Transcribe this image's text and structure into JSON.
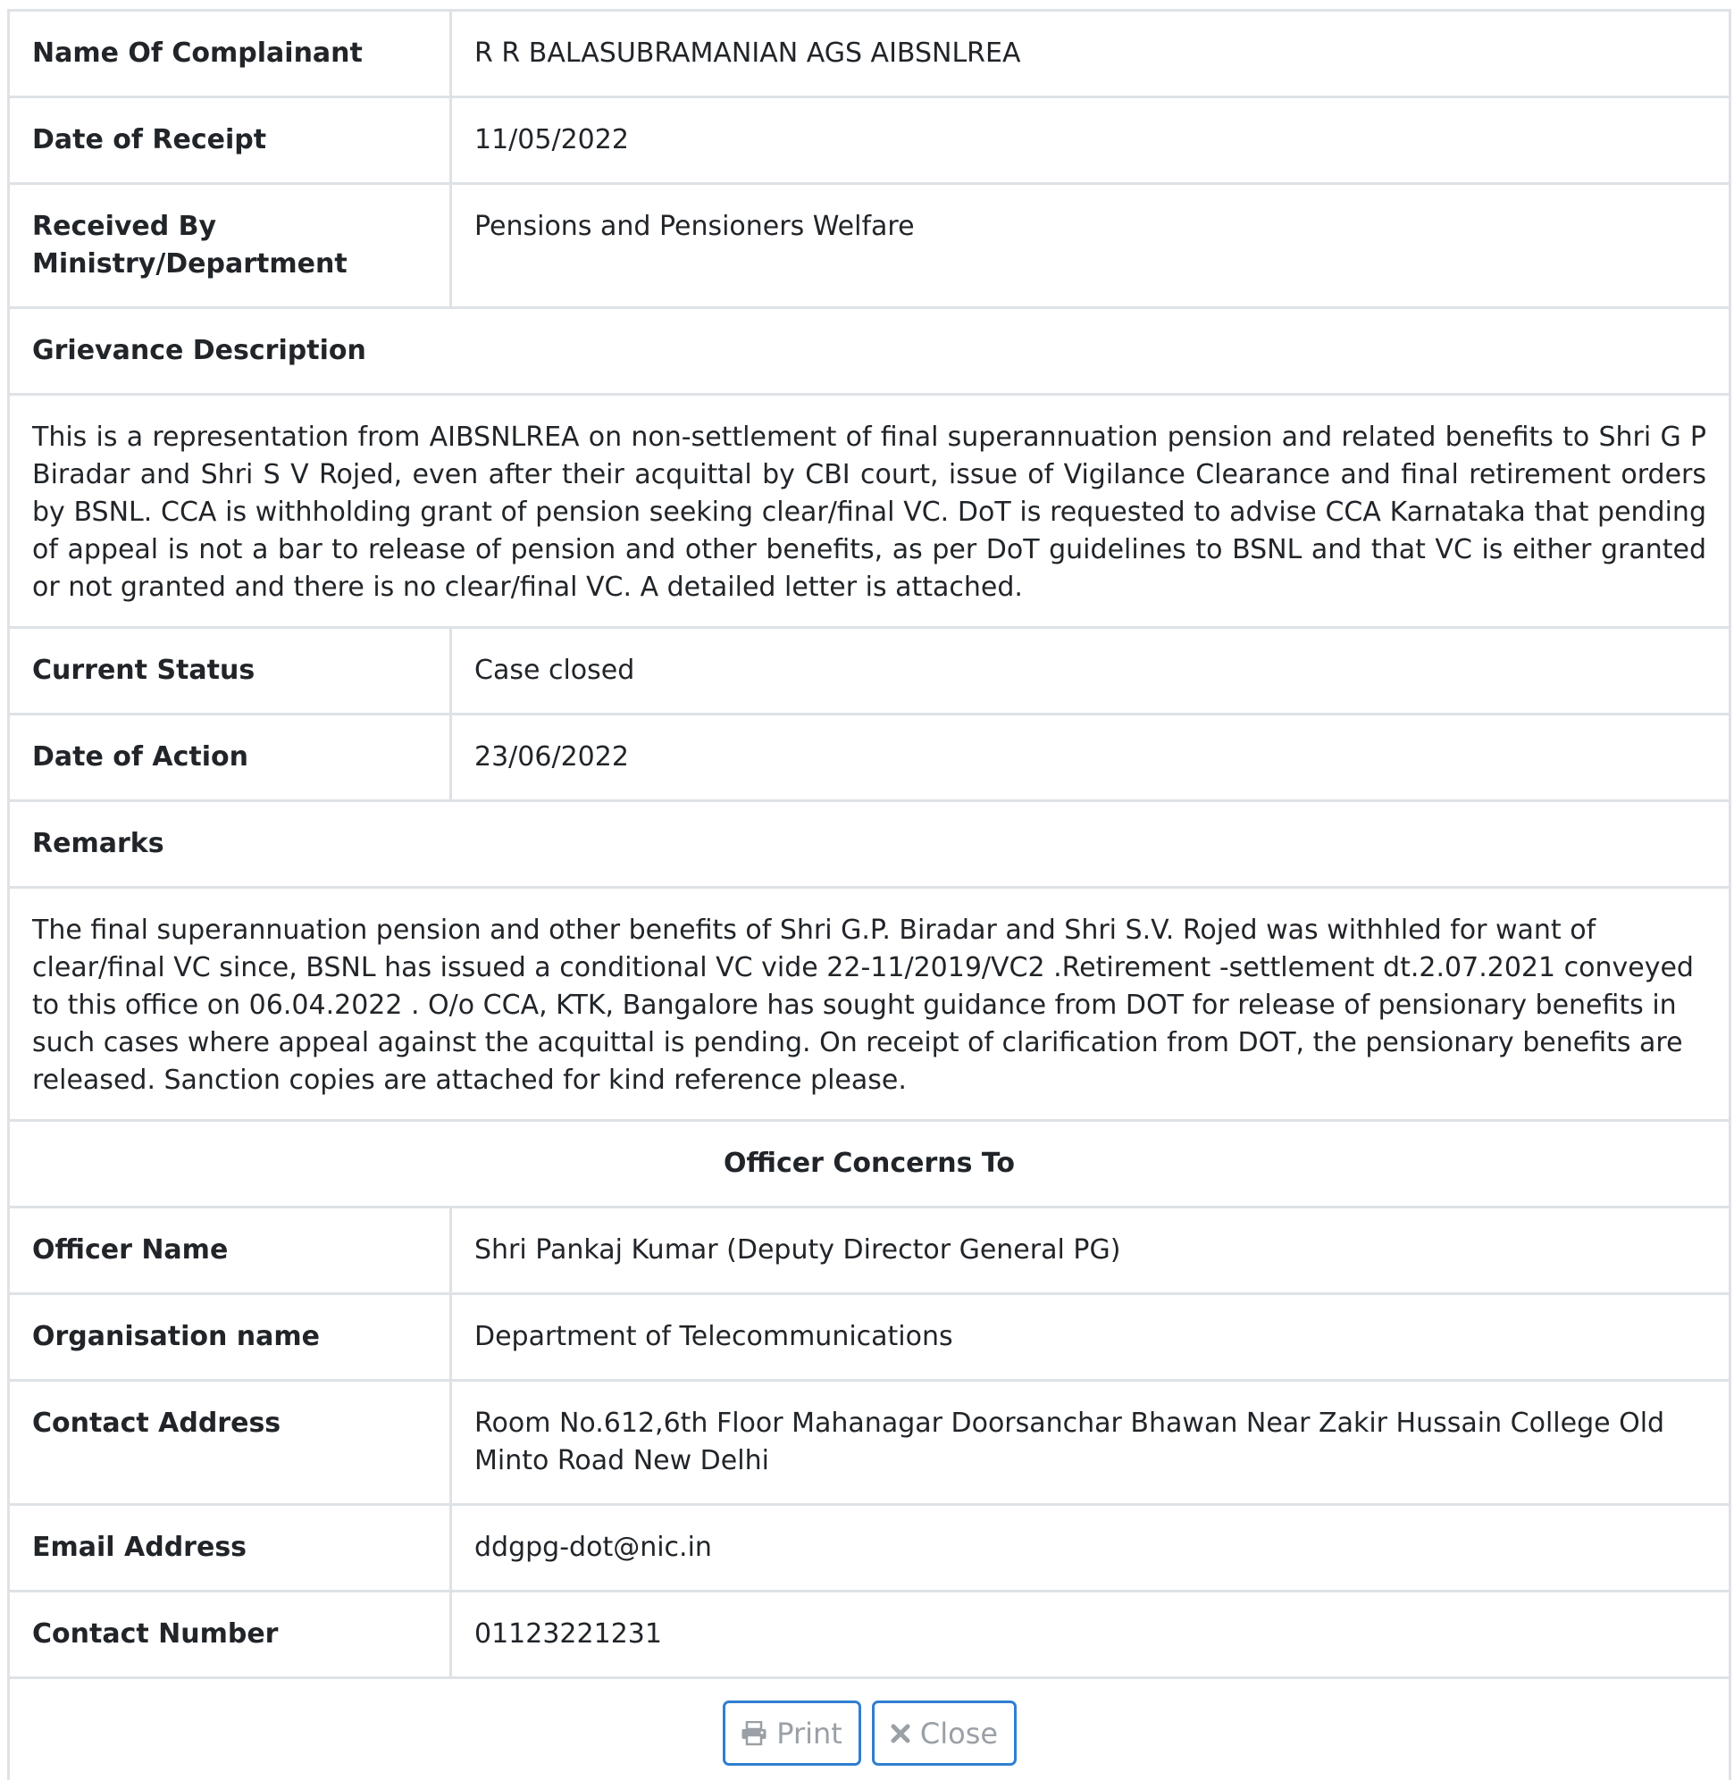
{
  "rows": {
    "complainant": {
      "label": "Name Of Complainant",
      "value": "R R BALASUBRAMANIAN AGS AIBSNLREA"
    },
    "receipt": {
      "label": "Date of Receipt",
      "value": "11/05/2022"
    },
    "received_by": {
      "label_line1": "Received By",
      "label_line2": "Ministry/Department",
      "value": "Pensions and Pensioners Welfare"
    },
    "grievance": {
      "label": "Grievance Description",
      "text": "This is a representation from AIBSNLREA on non-settlement of final superannuation pension and related benefits to Shri G P Biradar and Shri S V Rojed, even after their acquittal by CBI court, issue of Vigilance Clearance and final retirement orders by BSNL. CCA is withholding grant of pension seeking clear/final VC. DoT is requested to advise CCA Karnataka that pending of appeal is not a bar to release of pension and other benefits, as per DoT guidelines to BSNL and that VC is either granted or not granted and there is no clear/final VC. A detailed letter is attached."
    },
    "status": {
      "label": "Current Status",
      "value": "Case closed"
    },
    "action": {
      "label": "Date of Action",
      "value": "23/06/2022"
    },
    "remarks": {
      "label": "Remarks",
      "text": "The final superannuation pension and other benefits of Shri G.P. Biradar and Shri S.V. Rojed was withhled for want of clear/final VC since, BSNL has issued a conditional VC vide 22-11/2019/VC2 .Retirement -settlement dt.2.07.2021 conveyed to this office on 06.04.2022 . O/o CCA, KTK, Bangalore has sought guidance from DOT for release of pensionary benefits in such cases where appeal against the acquittal is pending. On receipt of clarification from DOT, the pensionary benefits are released. Sanction copies are attached for kind reference please."
    }
  },
  "officer": {
    "heading": "Officer Concerns To",
    "name": {
      "label": "Officer Name",
      "value": "Shri Pankaj Kumar (Deputy Director General PG)"
    },
    "organisation": {
      "label": "Organisation name",
      "value": "Department of Telecommunications"
    },
    "address": {
      "label": "Contact Address",
      "value": "Room No.612,6th Floor Mahanagar Doorsanchar Bhawan Near Zakir Hussain College Old Minto Road New Delhi"
    },
    "email": {
      "label": "Email Address",
      "value": "ddgpg-dot@nic.in"
    },
    "phone": {
      "label": "Contact Number",
      "value": "01123221231"
    }
  },
  "buttons": {
    "print": {
      "label": "Print",
      "icon": "printer-icon"
    },
    "close": {
      "label": "Close",
      "icon": "close-icon"
    }
  },
  "colors": {
    "border": "#dee2e6",
    "button_border": "#2f7fd0",
    "button_text": "#9aa0a6"
  }
}
